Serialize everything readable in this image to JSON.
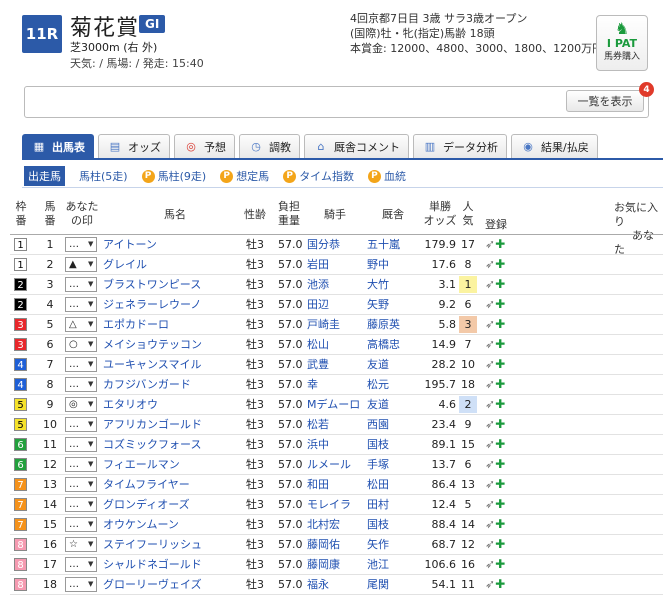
{
  "race": {
    "number": "11R",
    "name": "菊花賞",
    "grade": "GI",
    "distance": "芝3000m (右 外)",
    "conditions": "天気: / 馬場: / 発走: 15:40",
    "meta1": "4回京都7日目 3歳 サラ3歳オープン",
    "meta2": "(国際)牡・牝(指定)馬齢 18頭",
    "meta3": "本賞金: 12000、4800、3000、1800、1200万円"
  },
  "ipat": {
    "line1": "I PAT",
    "line2": "馬券購入"
  },
  "notice": {
    "button": "一覧を表示",
    "badge": "4"
  },
  "tabs": [
    {
      "label": "出馬表",
      "icon": "table-icon",
      "active": true
    },
    {
      "label": "オッズ",
      "icon": "odds-icon",
      "active": false
    },
    {
      "label": "予想",
      "icon": "target-icon",
      "active": false
    },
    {
      "label": "調教",
      "icon": "clock-icon",
      "active": false
    },
    {
      "label": "厩舎コメント",
      "icon": "stable-icon",
      "active": false
    },
    {
      "label": "データ分析",
      "icon": "chart-icon",
      "active": false
    },
    {
      "label": "結果/払戻",
      "icon": "coin-icon",
      "active": false
    }
  ],
  "subtabs": [
    {
      "label": "出走馬",
      "premium": false,
      "active": true
    },
    {
      "label": "馬柱(5走)",
      "premium": false,
      "active": false
    },
    {
      "label": "馬柱(9走)",
      "premium": true,
      "active": false
    },
    {
      "label": "想定馬",
      "premium": true,
      "active": false
    },
    {
      "label": "タイム指数",
      "premium": true,
      "active": false
    },
    {
      "label": "血統",
      "premium": true,
      "active": false
    }
  ],
  "header": {
    "waku": [
      "枠",
      "番"
    ],
    "umaban": [
      "馬",
      "番"
    ],
    "mark": [
      "あなた",
      "の印"
    ],
    "horse": "馬名",
    "sexage": "性齢",
    "weight": [
      "負担",
      "重量"
    ],
    "jockey": "騎手",
    "trainer": "厩舎",
    "odds": [
      "単勝",
      "オッズ"
    ],
    "pop": [
      "人",
      "気"
    ],
    "reg": "登録",
    "fav": [
      "お気に入り",
      "あなた"
    ]
  },
  "colors": {
    "waku": [
      "#ffffff",
      "#000000",
      "#e8262a",
      "#1e5fd6",
      "#f5e22a",
      "#22a03c",
      "#f5921a",
      "#f59ab0"
    ],
    "waku_text": [
      "#000000",
      "#ffffff",
      "#ffffff",
      "#ffffff",
      "#000000",
      "#ffffff",
      "#ffffff",
      "#ffffff"
    ],
    "pop": {
      "1": "#fbf3a0",
      "2": "#cfe0f7",
      "3": "#f3c9a8"
    }
  },
  "rows": [
    {
      "waku": "1",
      "umaban": "1",
      "mark": "…",
      "horse": "アイトーン",
      "sexage": "牡3",
      "weight": "57.0",
      "jockey": "国分恭",
      "trainer": "五十嵐",
      "odds": "179.9",
      "pop": "17"
    },
    {
      "waku": "1",
      "umaban": "2",
      "mark": "▲",
      "horse": "グレイル",
      "sexage": "牡3",
      "weight": "57.0",
      "jockey": "岩田",
      "trainer": "野中",
      "odds": "17.6",
      "pop": "8"
    },
    {
      "waku": "2",
      "umaban": "3",
      "mark": "…",
      "horse": "ブラストワンピース",
      "sexage": "牡3",
      "weight": "57.0",
      "jockey": "池添",
      "trainer": "大竹",
      "odds": "3.1",
      "pop": "1"
    },
    {
      "waku": "2",
      "umaban": "4",
      "mark": "…",
      "horse": "ジェネラーレウーノ",
      "sexage": "牡3",
      "weight": "57.0",
      "jockey": "田辺",
      "trainer": "矢野",
      "odds": "9.2",
      "pop": "6"
    },
    {
      "waku": "3",
      "umaban": "5",
      "mark": "△",
      "horse": "エポカドーロ",
      "sexage": "牡3",
      "weight": "57.0",
      "jockey": "戸崎圭",
      "trainer": "藤原英",
      "odds": "5.8",
      "pop": "3"
    },
    {
      "waku": "3",
      "umaban": "6",
      "mark": "○",
      "horse": "メイショウテッコン",
      "sexage": "牡3",
      "weight": "57.0",
      "jockey": "松山",
      "trainer": "高橋忠",
      "odds": "14.9",
      "pop": "7"
    },
    {
      "waku": "4",
      "umaban": "7",
      "mark": "…",
      "horse": "ユーキャンスマイル",
      "sexage": "牡3",
      "weight": "57.0",
      "jockey": "武豊",
      "trainer": "友道",
      "odds": "28.2",
      "pop": "10"
    },
    {
      "waku": "4",
      "umaban": "8",
      "mark": "…",
      "horse": "カフジバンガード",
      "sexage": "牡3",
      "weight": "57.0",
      "jockey": "幸",
      "trainer": "松元",
      "odds": "195.7",
      "pop": "18"
    },
    {
      "waku": "5",
      "umaban": "9",
      "mark": "◎",
      "horse": "エタリオウ",
      "sexage": "牡3",
      "weight": "57.0",
      "jockey": "Mデムーロ",
      "trainer": "友道",
      "odds": "4.6",
      "pop": "2"
    },
    {
      "waku": "5",
      "umaban": "10",
      "mark": "…",
      "horse": "アフリカンゴールド",
      "sexage": "牡3",
      "weight": "57.0",
      "jockey": "松若",
      "trainer": "西園",
      "odds": "23.4",
      "pop": "9"
    },
    {
      "waku": "6",
      "umaban": "11",
      "mark": "…",
      "horse": "コズミックフォース",
      "sexage": "牡3",
      "weight": "57.0",
      "jockey": "浜中",
      "trainer": "国枝",
      "odds": "89.1",
      "pop": "15"
    },
    {
      "waku": "6",
      "umaban": "12",
      "mark": "…",
      "horse": "フィエールマン",
      "sexage": "牡3",
      "weight": "57.0",
      "jockey": "ルメール",
      "trainer": "手塚",
      "odds": "13.7",
      "pop": "6"
    },
    {
      "waku": "7",
      "umaban": "13",
      "mark": "…",
      "horse": "タイムフライヤー",
      "sexage": "牡3",
      "weight": "57.0",
      "jockey": "和田",
      "trainer": "松田",
      "odds": "86.4",
      "pop": "13"
    },
    {
      "waku": "7",
      "umaban": "14",
      "mark": "…",
      "horse": "グロンディオーズ",
      "sexage": "牡3",
      "weight": "57.0",
      "jockey": "モレイラ",
      "trainer": "田村",
      "odds": "12.4",
      "pop": "5"
    },
    {
      "waku": "7",
      "umaban": "15",
      "mark": "…",
      "horse": "オウケンムーン",
      "sexage": "牡3",
      "weight": "57.0",
      "jockey": "北村宏",
      "trainer": "国枝",
      "odds": "88.4",
      "pop": "14"
    },
    {
      "waku": "8",
      "umaban": "16",
      "mark": "☆",
      "horse": "ステイフーリッシュ",
      "sexage": "牡3",
      "weight": "57.0",
      "jockey": "藤岡佑",
      "trainer": "矢作",
      "odds": "68.7",
      "pop": "12"
    },
    {
      "waku": "8",
      "umaban": "17",
      "mark": "…",
      "horse": "シャルドネゴールド",
      "sexage": "牡3",
      "weight": "57.0",
      "jockey": "藤岡康",
      "trainer": "池江",
      "odds": "106.6",
      "pop": "16"
    },
    {
      "waku": "8",
      "umaban": "18",
      "mark": "…",
      "horse": "グローリーヴェイズ",
      "sexage": "牡3",
      "weight": "57.0",
      "jockey": "福永",
      "trainer": "尾関",
      "odds": "54.1",
      "pop": "11"
    }
  ]
}
